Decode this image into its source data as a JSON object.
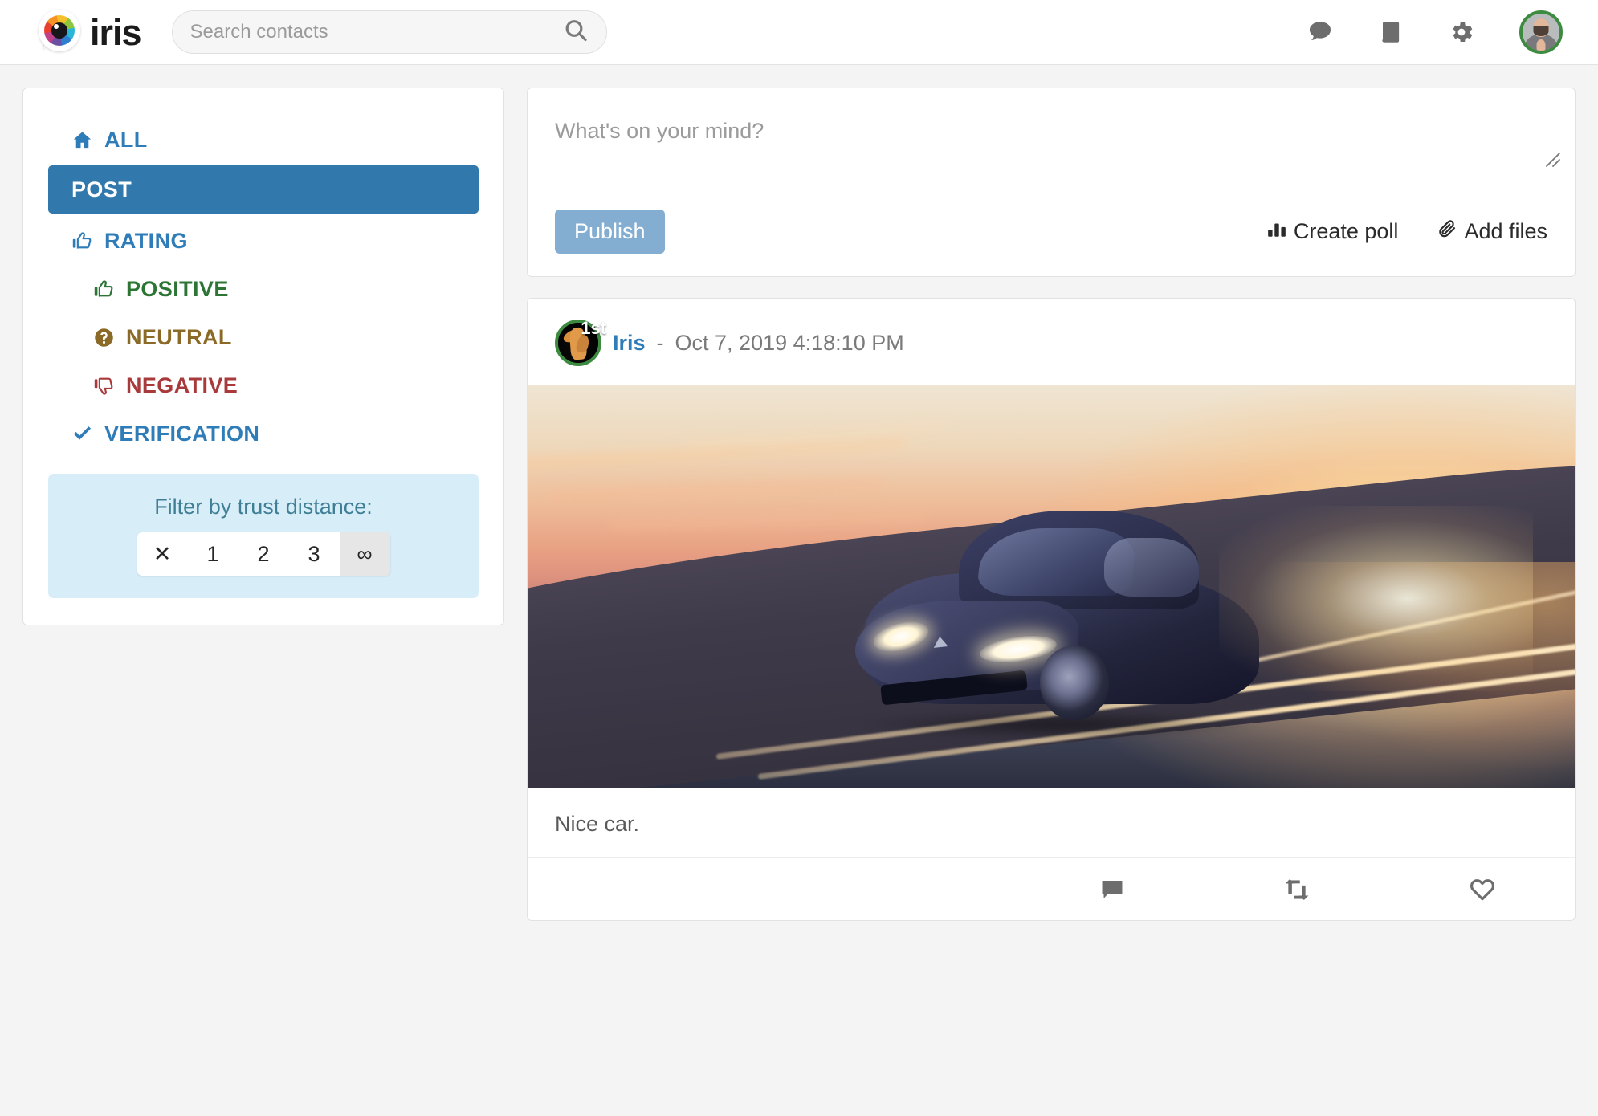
{
  "brand": {
    "name": "iris",
    "logo_icon": "iris-eye-logo"
  },
  "search": {
    "placeholder": "Search contacts",
    "value": "",
    "icon": "search-icon"
  },
  "topbar": {
    "icons": [
      {
        "name": "messages-icon",
        "glyph": "chat-bubble"
      },
      {
        "name": "contacts-book-icon",
        "glyph": "book"
      },
      {
        "name": "settings-gear-icon",
        "glyph": "gear"
      }
    ],
    "avatar_label": "user-avatar",
    "avatar_ring_color": "#3d8b40"
  },
  "sidebar": {
    "items": [
      {
        "label": "ALL",
        "icon": "home-icon",
        "active": false,
        "sub": false,
        "color": "#2e7cb8"
      },
      {
        "label": "POST",
        "icon": "",
        "active": true,
        "sub": false,
        "color": "#ffffff"
      },
      {
        "label": "RATING",
        "icon": "thumbs-up-icon",
        "active": false,
        "sub": false,
        "color": "#2e7cb8"
      },
      {
        "label": "POSITIVE",
        "icon": "thumbs-up-icon",
        "active": false,
        "sub": true,
        "color": "#2d7535"
      },
      {
        "label": "NEUTRAL",
        "icon": "question-circle-icon",
        "active": false,
        "sub": true,
        "color": "#8a6a26"
      },
      {
        "label": "NEGATIVE",
        "icon": "thumbs-down-icon",
        "active": false,
        "sub": true,
        "color": "#a93a3c"
      },
      {
        "label": "VERIFICATION",
        "icon": "check-icon",
        "active": false,
        "sub": false,
        "color": "#2e7cb8"
      }
    ],
    "trust_filter": {
      "label": "Filter by trust distance:",
      "options": [
        "✕",
        "1",
        "2",
        "3",
        "∞"
      ],
      "selected": "∞"
    }
  },
  "compose": {
    "placeholder": "What's on your mind?",
    "value": "",
    "publish_label": "Publish",
    "create_poll_label": "Create poll",
    "create_poll_icon": "bar-chart-icon",
    "add_files_label": "Add files",
    "add_files_icon": "paperclip-icon",
    "resize_handle": "resize-grip-icon"
  },
  "feed": {
    "posts": [
      {
        "author": "Iris",
        "separator": "-",
        "timestamp": "Oct 7, 2019 4:18:10 PM",
        "trust_badge": "1st",
        "avatar_name": "iris-avatar",
        "avatar_ring_color": "#3d8b40",
        "image_alt": "Dark blue Tesla driving on a road at sunset",
        "text": "Nice car.",
        "actions": [
          {
            "name": "comment-icon",
            "glyph": "chat-bubble-filled"
          },
          {
            "name": "repost-icon",
            "glyph": "retweet"
          },
          {
            "name": "like-icon",
            "glyph": "heart-outline"
          }
        ]
      }
    ]
  },
  "theme": {
    "accent_blue": "#2e7cb8",
    "active_blue": "#3178ac",
    "publish_blue": "#83aed2",
    "panel_blue": "#d7eef8",
    "page_bg": "#f4f4f4",
    "positive_green": "#2d7535",
    "neutral_brown": "#8a6a26",
    "negative_red": "#a93a3c"
  }
}
